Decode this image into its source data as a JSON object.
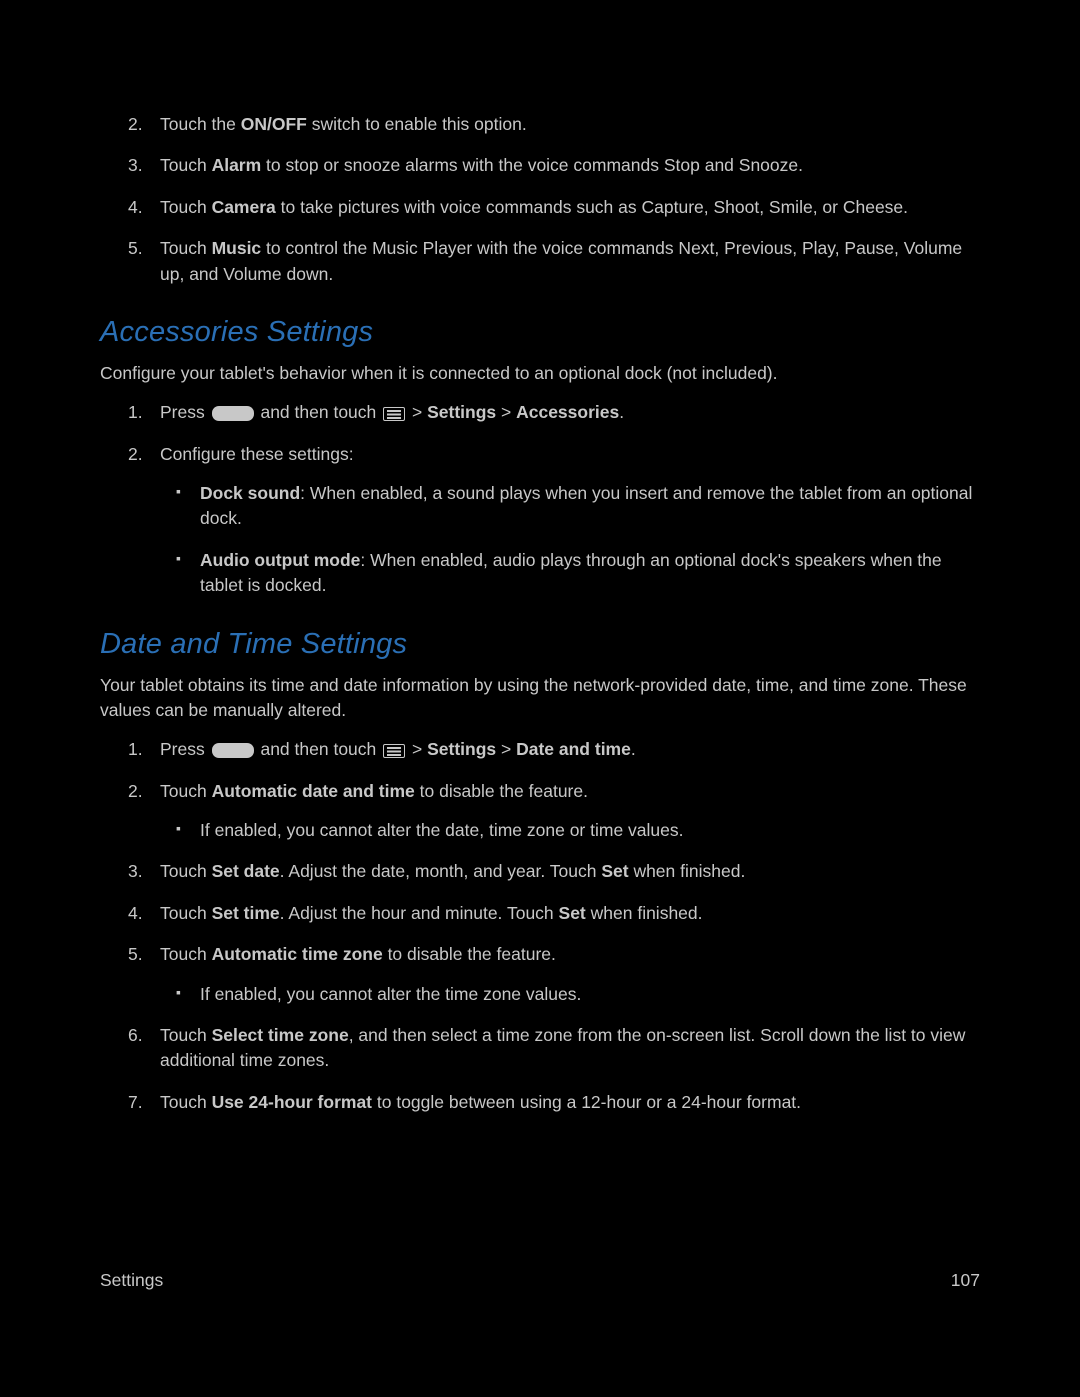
{
  "top_list": {
    "item2": {
      "pre": "Touch the ",
      "b1": "ON/OFF",
      "post": " switch to enable this option."
    },
    "item3": {
      "pre": "Touch ",
      "b1": "Alarm",
      "post": " to stop or snooze alarms with the voice commands Stop and Snooze."
    },
    "item4": {
      "pre": "Touch ",
      "b1": "Camera",
      "post": " to take pictures with voice commands such as Capture, Shoot, Smile, or Cheese."
    },
    "item5": {
      "pre": "Touch ",
      "b1": "Music",
      "post": " to control the Music Player with the voice commands Next, Previous, Play, Pause, Volume up, and Volume down."
    }
  },
  "accessories": {
    "heading": "Accessories Settings",
    "intro": "Configure your tablet's behavior when it is connected to an optional dock (not included).",
    "item1": {
      "pre": "Press ",
      "mid": " and then touch ",
      "sep": " > ",
      "b1": "Settings",
      "b2": "Accessories",
      "post": "."
    },
    "item2": "Configure these settings:",
    "bullets": {
      "b1": {
        "label": "Dock sound",
        "text": ": When enabled, a sound plays when you insert and remove the tablet from an optional dock."
      },
      "b2": {
        "label": "Audio output mode",
        "text": ": When enabled, audio plays through an optional dock's speakers when the tablet is docked."
      }
    }
  },
  "datetime": {
    "heading": "Date and Time Settings",
    "intro": "Your tablet obtains its time and date information by using the network-provided date, time, and time zone. These values can be manually altered.",
    "item1": {
      "pre": "Press ",
      "mid": " and then touch ",
      "sep": " > ",
      "b1": "Settings",
      "b2": "Date and time",
      "post": "."
    },
    "item2": {
      "pre": "Touch ",
      "b1": "Automatic date and time",
      "post": " to disable the feature."
    },
    "item2_sub": "If enabled, you cannot alter the date, time zone or time values.",
    "item3": {
      "pre": "Touch ",
      "b1": "Set date",
      "mid": ". Adjust the date, month, and year. Touch ",
      "b2": "Set",
      "post": " when finished."
    },
    "item4": {
      "pre": "Touch ",
      "b1": "Set time",
      "mid": ". Adjust the hour and minute. Touch ",
      "b2": "Set",
      "post": " when finished."
    },
    "item5": {
      "pre": "Touch ",
      "b1": "Automatic time zone",
      "post": " to disable the feature."
    },
    "item5_sub": "If enabled, you cannot alter the time zone values.",
    "item6": {
      "pre": "Touch ",
      "b1": "Select time zone",
      "post": ", and then select a time zone from the on-screen list. Scroll down the list to view additional time zones."
    },
    "item7": {
      "pre": "Touch ",
      "b1": "Use 24-hour format",
      "post": " to toggle between using a 12-hour or a 24-hour format."
    }
  },
  "footer": {
    "left": "Settings",
    "right": "107"
  }
}
